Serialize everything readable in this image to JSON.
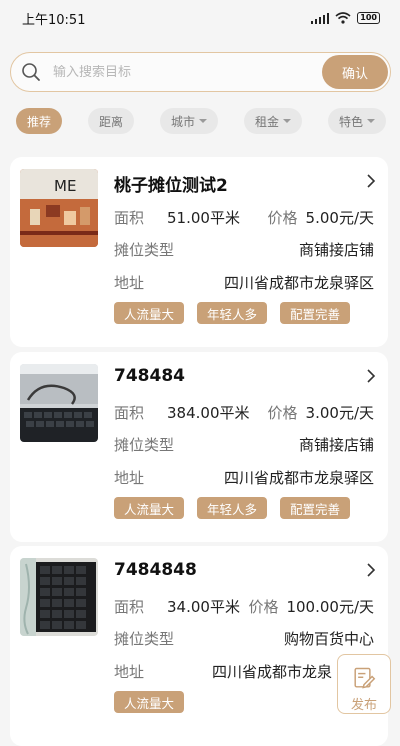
{
  "status": {
    "time": "上午10:51",
    "battery": "100"
  },
  "search": {
    "placeholder": "输入搜索目标",
    "confirm_label": "确认"
  },
  "filters": [
    {
      "label": "推荐",
      "active": true,
      "dropdown": false
    },
    {
      "label": "距离",
      "active": false,
      "dropdown": false
    },
    {
      "label": "城市",
      "active": false,
      "dropdown": true
    },
    {
      "label": "租金",
      "active": false,
      "dropdown": true
    },
    {
      "label": "特色",
      "active": false,
      "dropdown": true
    }
  ],
  "labels": {
    "area": "面积",
    "price": "价格",
    "type": "摊位类型",
    "address": "地址"
  },
  "listings": [
    {
      "title": "桃子摊位测试2",
      "area": "51.00平米",
      "price": "5.00元/天",
      "type": "商铺接店铺",
      "address": "四川省成都市龙泉驿区",
      "tags": [
        "人流量大",
        "年轻人多",
        "配置完善"
      ],
      "thumb_icon": "shelf-photo-icon"
    },
    {
      "title": "748484",
      "area": "384.00平米",
      "price": "3.00元/天",
      "type": "商铺接店铺",
      "address": "四川省成都市龙泉驿区",
      "tags": [
        "人流量大",
        "年轻人多",
        "配置完善"
      ],
      "thumb_icon": "laptop-photo-icon"
    },
    {
      "title": "7484848",
      "area": "34.00平米",
      "price": "100.00元/天",
      "type": "购物百货中心",
      "address": "四川省成都市龙泉",
      "tags": [
        "人流量大"
      ],
      "thumb_icon": "keyboard-photo-icon"
    }
  ],
  "publish": {
    "label": "发布",
    "icon": "edit-document-icon"
  },
  "colors": {
    "accent": "#c9a178",
    "chip_bg": "#e8e8e8",
    "background": "#f5f5f5"
  }
}
